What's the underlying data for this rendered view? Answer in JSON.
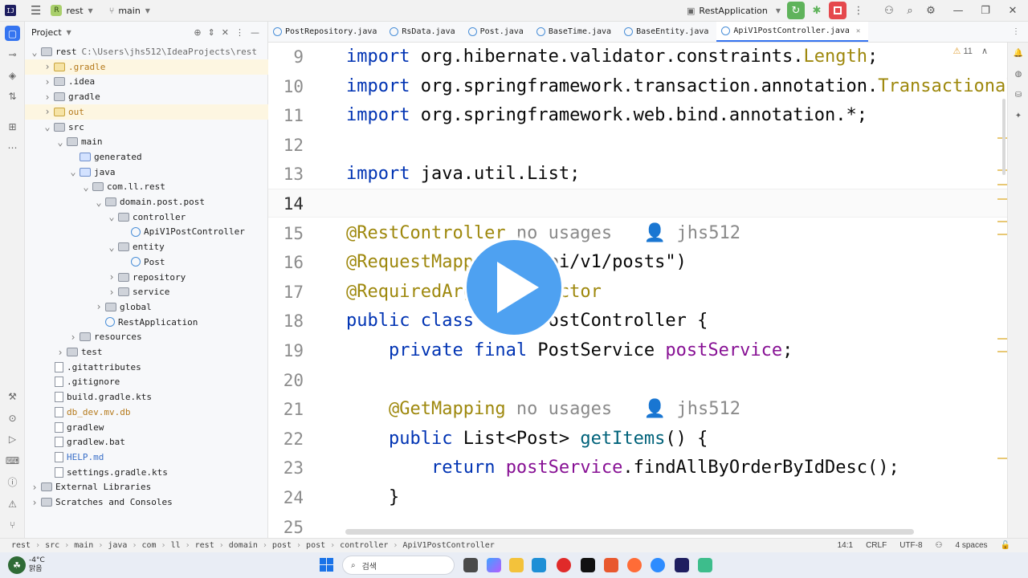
{
  "titlebar": {
    "project_badge": "R",
    "project_name": "rest",
    "branch": "main",
    "run_config": "RestApplication"
  },
  "colors": {
    "accent": "#3574f0",
    "play_overlay": "#4ea1f1",
    "run_green": "#5fb35b",
    "stop_red": "#e5484d"
  },
  "project_panel": {
    "title": "Project",
    "tree": [
      {
        "label": "rest",
        "extra": "C:\\Users\\jhs512\\IdeaProjects\\rest",
        "depth": 0,
        "icon": "folder-icon",
        "arrow": "v"
      },
      {
        "label": ".gradle",
        "depth": 1,
        "icon": "folder-icon",
        "arrow": ">",
        "style": "orange",
        "hl": true
      },
      {
        "label": ".idea",
        "depth": 1,
        "icon": "folder-icon",
        "arrow": ">"
      },
      {
        "label": "gradle",
        "depth": 1,
        "icon": "folder-icon",
        "arrow": ">"
      },
      {
        "label": "out",
        "depth": 1,
        "icon": "folder-icon",
        "arrow": ">",
        "style": "orange",
        "hl": true
      },
      {
        "label": "src",
        "depth": 1,
        "icon": "folder-icon",
        "arrow": "v"
      },
      {
        "label": "main",
        "depth": 2,
        "icon": "folder-icon",
        "arrow": "v"
      },
      {
        "label": "generated",
        "depth": 3,
        "icon": "folder-icon",
        "arrow": ""
      },
      {
        "label": "java",
        "depth": 3,
        "icon": "folder-icon",
        "arrow": "v"
      },
      {
        "label": "com.ll.rest",
        "depth": 4,
        "icon": "package-icon",
        "arrow": "v"
      },
      {
        "label": "domain.post.post",
        "depth": 5,
        "icon": "package-icon",
        "arrow": "v"
      },
      {
        "label": "controller",
        "depth": 6,
        "icon": "package-icon",
        "arrow": "v"
      },
      {
        "label": "ApiV1PostController",
        "depth": 7,
        "icon": "class-icon",
        "arrow": ""
      },
      {
        "label": "entity",
        "depth": 6,
        "icon": "package-icon",
        "arrow": "v"
      },
      {
        "label": "Post",
        "depth": 7,
        "icon": "class-icon",
        "arrow": ""
      },
      {
        "label": "repository",
        "depth": 6,
        "icon": "package-icon",
        "arrow": ">"
      },
      {
        "label": "service",
        "depth": 6,
        "icon": "package-icon",
        "arrow": ">"
      },
      {
        "label": "global",
        "depth": 5,
        "icon": "package-icon",
        "arrow": ">"
      },
      {
        "label": "RestApplication",
        "depth": 5,
        "icon": "class-icon",
        "arrow": ""
      },
      {
        "label": "resources",
        "depth": 3,
        "icon": "folder-icon",
        "arrow": ">"
      },
      {
        "label": "test",
        "depth": 2,
        "icon": "folder-icon",
        "arrow": ">"
      },
      {
        "label": ".gitattributes",
        "depth": 1,
        "icon": "file-icon",
        "arrow": ""
      },
      {
        "label": ".gitignore",
        "depth": 1,
        "icon": "file-icon",
        "arrow": ""
      },
      {
        "label": "build.gradle.kts",
        "depth": 1,
        "icon": "gradle-file-icon",
        "arrow": ""
      },
      {
        "label": "db_dev.mv.db",
        "depth": 1,
        "icon": "file-icon",
        "arrow": "",
        "style": "orange"
      },
      {
        "label": "gradlew",
        "depth": 1,
        "icon": "file-icon",
        "arrow": ""
      },
      {
        "label": "gradlew.bat",
        "depth": 1,
        "icon": "file-icon",
        "arrow": ""
      },
      {
        "label": "HELP.md",
        "depth": 1,
        "icon": "markdown-file-icon",
        "arrow": ""
      },
      {
        "label": "settings.gradle.kts",
        "depth": 1,
        "icon": "gradle-file-icon",
        "arrow": ""
      },
      {
        "label": "External Libraries",
        "depth": 0,
        "icon": "library-icon",
        "arrow": ">"
      },
      {
        "label": "Scratches and Consoles",
        "depth": 0,
        "icon": "scratch-icon",
        "arrow": ">"
      }
    ]
  },
  "tabs": [
    {
      "label": "PostRepository.java",
      "active": false
    },
    {
      "label": "RsData.java",
      "active": false
    },
    {
      "label": "Post.java",
      "active": false
    },
    {
      "label": "BaseTime.java",
      "active": false
    },
    {
      "label": "BaseEntity.java",
      "active": false
    },
    {
      "label": "ApiV1PostController.java",
      "active": true
    }
  ],
  "editor": {
    "warnings": "11",
    "current_line": "14",
    "lines": [
      {
        "n": "9",
        "tokens": [
          {
            "t": "import ",
            "c": "kw"
          },
          {
            "t": "org.hibernate.validator.constraints."
          },
          {
            "t": "Length",
            "c": "typ"
          },
          {
            "t": ";"
          }
        ]
      },
      {
        "n": "10",
        "tokens": [
          {
            "t": "import ",
            "c": "kw"
          },
          {
            "t": "org.springframework.transaction.annotation."
          },
          {
            "t": "Transactional",
            "c": "typ"
          },
          {
            "t": ";"
          }
        ]
      },
      {
        "n": "11",
        "tokens": [
          {
            "t": "import ",
            "c": "kw"
          },
          {
            "t": "org.springframework.web.bind.annotation.*;"
          }
        ]
      },
      {
        "n": "12",
        "tokens": []
      },
      {
        "n": "13",
        "tokens": [
          {
            "t": "import ",
            "c": "kw"
          },
          {
            "t": "java.util.List;"
          }
        ]
      },
      {
        "n": "14",
        "tokens": []
      },
      {
        "n": "15",
        "tokens": [
          {
            "t": "@RestController",
            "c": "an"
          },
          {
            "t": " no usages   ",
            "c": "hint"
          },
          {
            "t": "👤 jhs512",
            "c": "hint"
          }
        ]
      },
      {
        "n": "16",
        "tokens": [
          {
            "t": "@RequestMapping",
            "c": "an"
          },
          {
            "t": "(\"/api/v1/posts\")"
          }
        ]
      },
      {
        "n": "17",
        "tokens": [
          {
            "t": "@RequiredArgsConstructor",
            "c": "an"
          }
        ]
      },
      {
        "n": "18",
        "tokens": [
          {
            "t": "public class ",
            "c": "kw"
          },
          {
            "t": "ApiV1PostController {"
          }
        ]
      },
      {
        "n": "19",
        "tokens": [
          {
            "t": "    "
          },
          {
            "t": "private final ",
            "c": "kw"
          },
          {
            "t": "PostService "
          },
          {
            "t": "postService",
            "c": "fld"
          },
          {
            "t": ";"
          }
        ]
      },
      {
        "n": "20",
        "tokens": []
      },
      {
        "n": "21",
        "tokens": [
          {
            "t": "    "
          },
          {
            "t": "@GetMapping",
            "c": "an"
          },
          {
            "t": " no usages   ",
            "c": "hint"
          },
          {
            "t": "👤 jhs512",
            "c": "hint"
          }
        ]
      },
      {
        "n": "22",
        "tokens": [
          {
            "t": "    "
          },
          {
            "t": "public ",
            "c": "kw"
          },
          {
            "t": "List<Post> "
          },
          {
            "t": "getItems",
            "c": "mtd"
          },
          {
            "t": "() {"
          }
        ]
      },
      {
        "n": "23",
        "tokens": [
          {
            "t": "        "
          },
          {
            "t": "return ",
            "c": "kw"
          },
          {
            "t": "postService",
            "c": "fld"
          },
          {
            "t": ".findAllByOrderByIdDesc();"
          }
        ]
      },
      {
        "n": "24",
        "tokens": [
          {
            "t": "    }"
          }
        ]
      },
      {
        "n": "25",
        "tokens": []
      }
    ]
  },
  "statusbar": {
    "breadcrumb": [
      "rest",
      "src",
      "main",
      "java",
      "com",
      "ll",
      "rest",
      "domain",
      "post",
      "post",
      "controller",
      "ApiV1PostController"
    ],
    "position": "14:1",
    "line_sep": "CRLF",
    "encoding": "UTF-8",
    "indent": "4 spaces"
  },
  "taskbar": {
    "weather_temp": "-4°C",
    "weather_desc": "맑음",
    "search_placeholder": "검색"
  }
}
